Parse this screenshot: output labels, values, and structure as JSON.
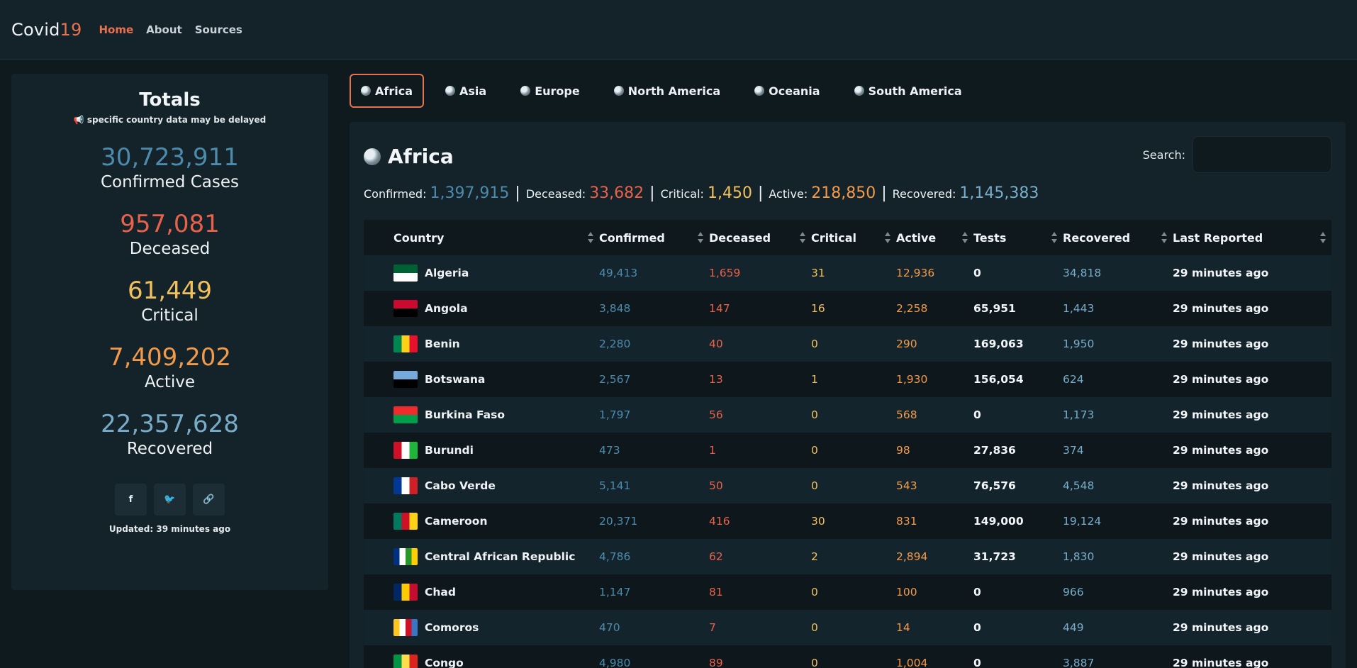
{
  "nav": {
    "brand_main": "Covid",
    "brand_accent": "19",
    "links": [
      "Home",
      "About",
      "Sources"
    ]
  },
  "totals": {
    "title": "Totals",
    "note": "📢 specific country data may be delayed",
    "stats": [
      {
        "value": "30,723,911",
        "label": "Confirmed Cases"
      },
      {
        "value": "957,081",
        "label": "Deceased"
      },
      {
        "value": "61,449",
        "label": "Critical"
      },
      {
        "value": "7,409,202",
        "label": "Active"
      },
      {
        "value": "22,357,628",
        "label": "Recovered"
      }
    ],
    "social": [
      "f",
      "🐦",
      "🔗"
    ],
    "updated": "Updated: 39 minutes ago"
  },
  "tabs": [
    "Africa",
    "Asia",
    "Europe",
    "North America",
    "Oceania",
    "South America"
  ],
  "main": {
    "title": "Africa",
    "search_label": "Search:",
    "summary": {
      "confirmed_label": "Confirmed:",
      "confirmed": "1,397,915",
      "deceased_label": "Deceased:",
      "deceased": "33,682",
      "critical_label": "Critical:",
      "critical": "1,450",
      "active_label": "Active:",
      "active": "218,850",
      "recovered_label": "Recovered:",
      "recovered": "1,145,383"
    },
    "columns": [
      "Country",
      "Confirmed",
      "Deceased",
      "Critical",
      "Active",
      "Tests",
      "Recovered",
      "Last Reported"
    ],
    "rows": [
      {
        "country": "Algeria",
        "confirmed": "49,413",
        "deceased": "1,659",
        "critical": "31",
        "active": "12,936",
        "tests": "0",
        "recovered": "34,818",
        "last": "29 minutes ago",
        "flag": [
          "#006233",
          "#ffffff"
        ]
      },
      {
        "country": "Angola",
        "confirmed": "3,848",
        "deceased": "147",
        "critical": "16",
        "active": "2,258",
        "tests": "65,951",
        "recovered": "1,443",
        "last": "29 minutes ago",
        "flag": [
          "#cc092f",
          "#000000"
        ]
      },
      {
        "country": "Benin",
        "confirmed": "2,280",
        "deceased": "40",
        "critical": "0",
        "active": "290",
        "tests": "169,063",
        "recovered": "1,950",
        "last": "29 minutes ago",
        "flag": [
          "#008751",
          "#fcd116",
          "#e8112d"
        ]
      },
      {
        "country": "Botswana",
        "confirmed": "2,567",
        "deceased": "13",
        "critical": "1",
        "active": "1,930",
        "tests": "156,054",
        "recovered": "624",
        "last": "29 minutes ago",
        "flag": [
          "#75aadb",
          "#000000"
        ]
      },
      {
        "country": "Burkina Faso",
        "confirmed": "1,797",
        "deceased": "56",
        "critical": "0",
        "active": "568",
        "tests": "0",
        "recovered": "1,173",
        "last": "29 minutes ago",
        "flag": [
          "#ef2b2d",
          "#009e49"
        ]
      },
      {
        "country": "Burundi",
        "confirmed": "473",
        "deceased": "1",
        "critical": "0",
        "active": "98",
        "tests": "27,836",
        "recovered": "374",
        "last": "29 minutes ago",
        "flag": [
          "#ce1126",
          "#ffffff",
          "#1eb53a"
        ]
      },
      {
        "country": "Cabo Verde",
        "confirmed": "5,141",
        "deceased": "50",
        "critical": "0",
        "active": "543",
        "tests": "76,576",
        "recovered": "4,548",
        "last": "29 minutes ago",
        "flag": [
          "#003893",
          "#ffffff",
          "#cf2027"
        ]
      },
      {
        "country": "Cameroon",
        "confirmed": "20,371",
        "deceased": "416",
        "critical": "30",
        "active": "831",
        "tests": "149,000",
        "recovered": "19,124",
        "last": "29 minutes ago",
        "flag": [
          "#007a5e",
          "#ce1126",
          "#fcd116"
        ]
      },
      {
        "country": "Central African Republic",
        "confirmed": "4,786",
        "deceased": "62",
        "critical": "2",
        "active": "2,894",
        "tests": "31,723",
        "recovered": "1,830",
        "last": "29 minutes ago",
        "flag": [
          "#003082",
          "#ffffff",
          "#289728",
          "#ffce00"
        ]
      },
      {
        "country": "Chad",
        "confirmed": "1,147",
        "deceased": "81",
        "critical": "0",
        "active": "100",
        "tests": "0",
        "recovered": "966",
        "last": "29 minutes ago",
        "flag": [
          "#002664",
          "#fecb00",
          "#c60c30"
        ]
      },
      {
        "country": "Comoros",
        "confirmed": "470",
        "deceased": "7",
        "critical": "0",
        "active": "14",
        "tests": "0",
        "recovered": "449",
        "last": "29 minutes ago",
        "flag": [
          "#ffc61e",
          "#ffffff",
          "#ce1126",
          "#3a75c4"
        ]
      },
      {
        "country": "Congo",
        "confirmed": "4,980",
        "deceased": "89",
        "critical": "0",
        "active": "1,004",
        "tests": "0",
        "recovered": "3,887",
        "last": "29 minutes ago",
        "flag": [
          "#009543",
          "#fbde4a",
          "#dc241f"
        ]
      }
    ]
  }
}
